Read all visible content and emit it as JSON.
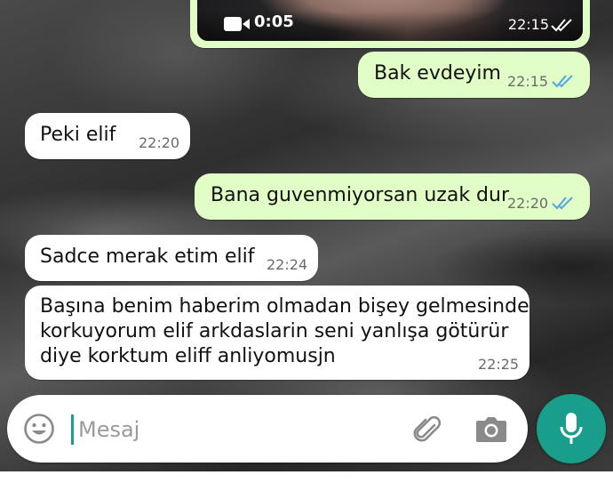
{
  "colors": {
    "outgoing_bubble": "#e1fec6",
    "incoming_bubble": "#ffffff",
    "read_ticks": "#4fa6e0",
    "accent": "#1a9e8c"
  },
  "video_message": {
    "duration": "0:05",
    "time": "22:15",
    "status": "read",
    "icon": "video-camera-icon"
  },
  "messages": [
    {
      "direction": "outgoing",
      "text": "Bak evdeyim",
      "time": "22:15",
      "status": "read"
    },
    {
      "direction": "incoming",
      "text": "Peki elif",
      "time": "22:20"
    },
    {
      "direction": "outgoing",
      "text": "Bana guvenmiyorsan uzak dur",
      "time": "22:20",
      "status": "read"
    },
    {
      "direction": "incoming",
      "text": "Sadce merak etim elif",
      "time": "22:24"
    },
    {
      "direction": "incoming",
      "text": "Başına benim haberim olmadan bişey gelmesinde\nkorkuyorum elif arkdaslarin seni yanlışa götürür\ndiye korktum eliff anliyomusjn",
      "time": "22:25"
    }
  ],
  "input": {
    "placeholder": "Mesaj",
    "value": "",
    "icons": [
      "emoji-icon",
      "attach-icon",
      "camera-icon",
      "mic-icon"
    ]
  }
}
